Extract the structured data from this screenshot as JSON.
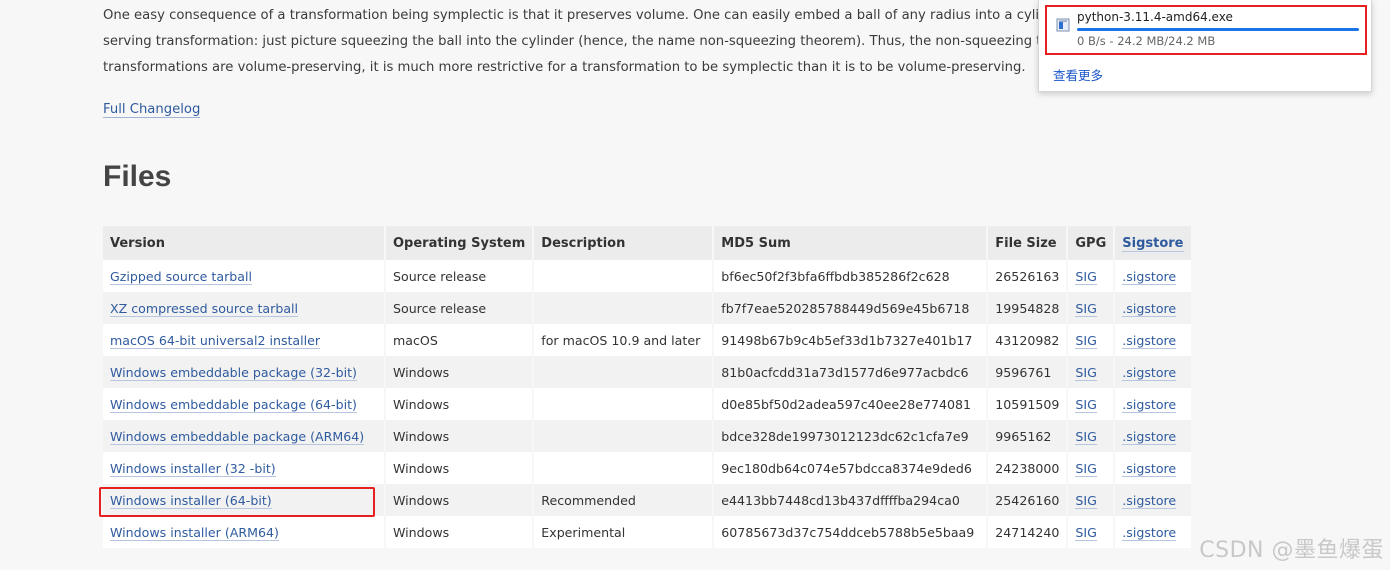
{
  "intro": {
    "lines": [
      "One easy consequence of a transformation being symplectic is that it preserves volume. One can easily embed a ball of any radius into a cylinder of any other radi",
      "serving transformation: just picture squeezing the ball into the cylinder (hence, the name non-squeezing theorem). Thus, the non-squeezing theorem tells us that",
      "transformations are volume-preserving, it is much more restrictive for a transformation to be symplectic than it is to be volume-preserving."
    ]
  },
  "changelog_link": "Full Changelog",
  "files_heading": "Files",
  "table": {
    "headers": {
      "version": "Version",
      "os": "Operating System",
      "description": "Description",
      "md5": "MD5 Sum",
      "size": "File Size",
      "gpg": "GPG",
      "sigstore": "Sigstore"
    },
    "rows": [
      {
        "version": "Gzipped source tarball",
        "os": "Source release",
        "description": "",
        "md5": "bf6ec50f2f3bfa6ffbdb385286f2c628",
        "size": "26526163",
        "gpg": "SIG",
        "sigstore": ".sigstore"
      },
      {
        "version": "XZ compressed source tarball",
        "os": "Source release",
        "description": "",
        "md5": "fb7f7eae520285788449d569e45b6718",
        "size": "19954828",
        "gpg": "SIG",
        "sigstore": ".sigstore"
      },
      {
        "version": "macOS 64-bit universal2 installer",
        "os": "macOS",
        "description": "for macOS 10.9 and later",
        "md5": "91498b67b9c4b5ef33d1b7327e401b17",
        "size": "43120982",
        "gpg": "SIG",
        "sigstore": ".sigstore"
      },
      {
        "version": "Windows embeddable package (32-bit)",
        "os": "Windows",
        "description": "",
        "md5": "81b0acfcdd31a73d1577d6e977acbdc6",
        "size": "9596761",
        "gpg": "SIG",
        "sigstore": ".sigstore"
      },
      {
        "version": "Windows embeddable package (64-bit)",
        "os": "Windows",
        "description": "",
        "md5": "d0e85bf50d2adea597c40ee28e774081",
        "size": "10591509",
        "gpg": "SIG",
        "sigstore": ".sigstore"
      },
      {
        "version": "Windows embeddable package (ARM64)",
        "os": "Windows",
        "description": "",
        "md5": "bdce328de19973012123dc62c1cfa7e9",
        "size": "9965162",
        "gpg": "SIG",
        "sigstore": ".sigstore"
      },
      {
        "version": "Windows installer (32 -bit)",
        "os": "Windows",
        "description": "",
        "md5": "9ec180db64c074e57bdcca8374e9ded6",
        "size": "24238000",
        "gpg": "SIG",
        "sigstore": ".sigstore"
      },
      {
        "version": "Windows installer (64-bit)",
        "os": "Windows",
        "description": "Recommended",
        "md5": "e4413bb7448cd13b437dffffba294ca0",
        "size": "25426160",
        "gpg": "SIG",
        "sigstore": ".sigstore"
      },
      {
        "version": "Windows installer (ARM64)",
        "os": "Windows",
        "description": "Experimental",
        "md5": "60785673d37c754ddceb5788b5e5baa9",
        "size": "24714240",
        "gpg": "SIG",
        "sigstore": ".sigstore"
      }
    ]
  },
  "download_panel": {
    "file_name": "python-3.11.4-amd64.exe",
    "status": "0 B/s - 24.2 MB/24.2 MB",
    "progress_percent": 100,
    "show_more": "查看更多",
    "icon": "installer-file-icon"
  },
  "watermark": "CSDN @墨鱼爆蛋",
  "colors": {
    "link": "#2f5b9e",
    "highlight": "#e52020",
    "progress": "#1a73e8"
  }
}
